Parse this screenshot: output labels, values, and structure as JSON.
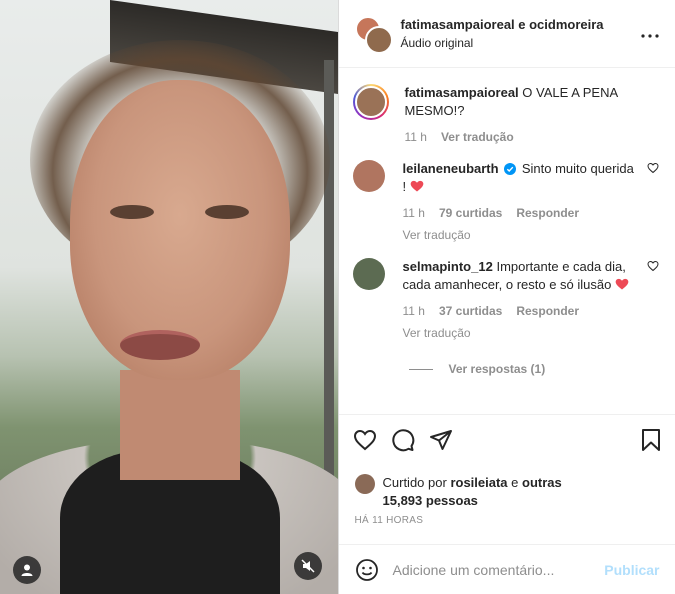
{
  "header": {
    "users": "fatimasampaioreal e ocidmoreira",
    "audio": "Áudio original",
    "more_icon": "more-horizontal-icon"
  },
  "caption": {
    "username": "fatimasampaioreal",
    "text": "O VALE A PENA MESMO!?",
    "time": "11 h",
    "translate": "Ver tradução"
  },
  "comments": [
    {
      "username": "leilaneneubarth",
      "verified": true,
      "text": "Sinto muito querida ! ",
      "time": "11 h",
      "likes": "79 curtidas",
      "reply": "Responder",
      "translate": "Ver tradução"
    },
    {
      "username": "selmapinto_12",
      "verified": false,
      "text": "Importante e cada dia, cada amanhecer, o resto e só ilusão ",
      "time": "11 h",
      "likes": "37 curtidas",
      "reply": "Responder",
      "translate": "Ver tradução",
      "view_replies": "Ver respostas (1)"
    }
  ],
  "likes": {
    "prefix": "Curtido por",
    "user": "rosileiata",
    "mid": "e",
    "others": "outras 15,893 pessoas"
  },
  "timestamp": "HÁ 11 HORAS",
  "composer": {
    "placeholder": "Adicione um comentário...",
    "publish": "Publicar"
  },
  "colors": {
    "heart_red": "#ed4956",
    "verified_blue": "#0095f6",
    "publish_disabled": "#b2dffc"
  }
}
